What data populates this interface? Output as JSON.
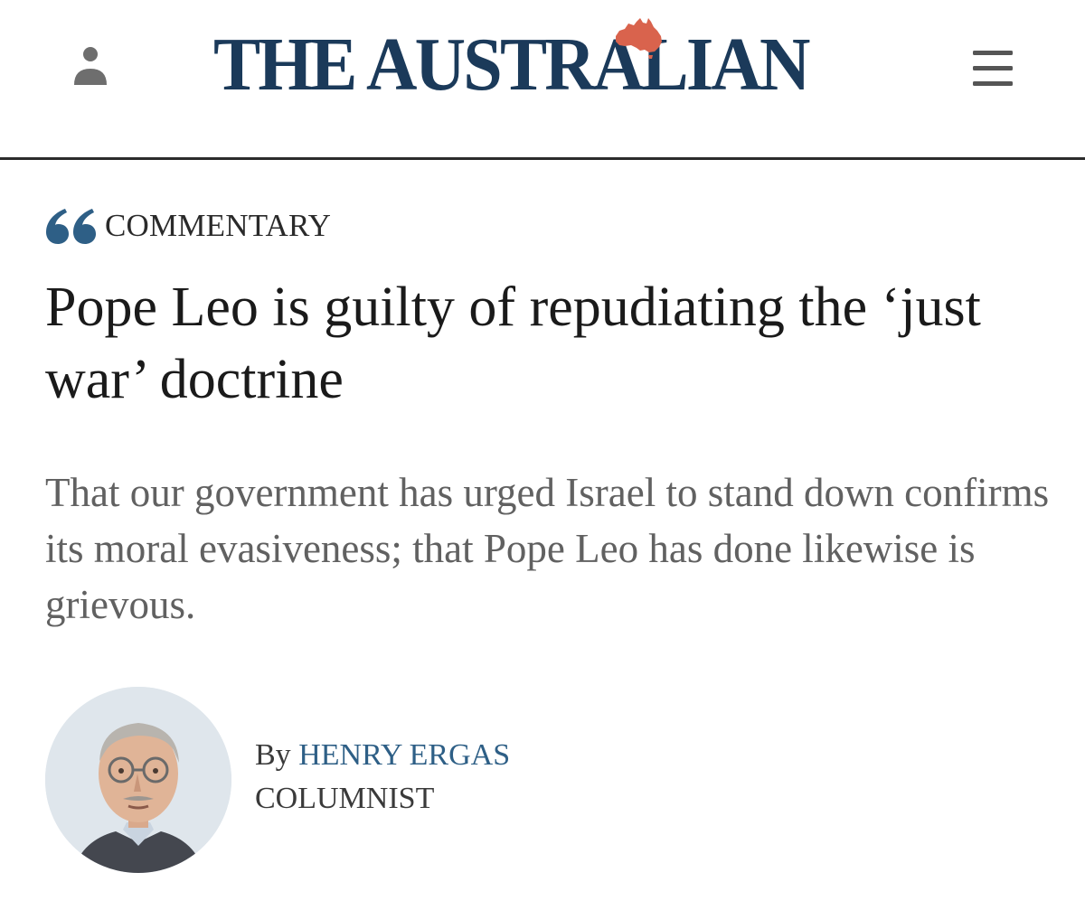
{
  "header": {
    "logo_text": "THE AUSTRALIAN",
    "brand_color": "#1b3a5a",
    "map_color": "#d9634d",
    "user_icon": "user-icon",
    "menu_icon": "hamburger-menu-icon"
  },
  "article": {
    "category_icon": "quote-icon",
    "category": "COMMENTARY",
    "headline": "Pope Leo is guilty of repudiating the ‘just war’ doctrine",
    "standfirst": "That our government has urged Israel to stand down confirms its moral evasiveness; that Pope Leo has done likewise is grievous.",
    "byline": {
      "prefix": "By",
      "author": "HENRY ERGAS",
      "role": "COLUMNIST"
    }
  },
  "colors": {
    "accent": "#2e5f86",
    "headline": "#1a1a1a",
    "standfirst": "#616161",
    "rule": "#2b2b2b"
  }
}
